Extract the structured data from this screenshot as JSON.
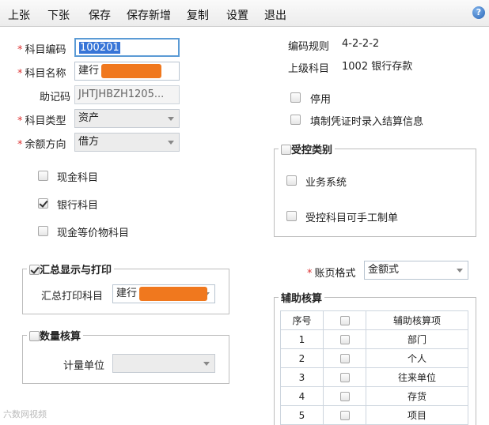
{
  "toolbar": {
    "items": [
      "上张",
      "下张",
      "保存",
      "保存新增",
      "复制",
      "设置",
      "退出"
    ],
    "help_icon": "help-icon",
    "help_glyph": "?"
  },
  "form": {
    "code_label": "科目编码",
    "code_value": "100201",
    "name_label": "科目名称",
    "name_value": "建行",
    "mnemonic_label": "助记码",
    "mnemonic_value": "JHTJHBZH1205...",
    "type_label": "科目类型",
    "type_value": "资产",
    "balance_label": "余额方向",
    "balance_value": "借方",
    "cash_label": "现金科目",
    "bank_label": "银行科目",
    "equiv_label": "现金等价物科目",
    "cash_checked": false,
    "bank_checked": true,
    "equiv_checked": false
  },
  "summary": {
    "legend": "汇总显示与打印",
    "checked": true,
    "print_label": "汇总打印科目",
    "print_value": "建行"
  },
  "qty": {
    "legend": "数量核算",
    "checked": false,
    "unit_label": "计量单位",
    "unit_value": ""
  },
  "right": {
    "rule_label": "编码规则",
    "rule_value": "4-2-2-2",
    "parent_label": "上级科目",
    "parent_value": "1002 银行存款",
    "disable_label": "停用",
    "settle_label": "填制凭证时录入结算信息"
  },
  "controlled": {
    "legend": "受控类别",
    "business_label": "业务系统",
    "manual_label": "受控科目可手工制单"
  },
  "ledger": {
    "label": "账页格式",
    "value": "金额式"
  },
  "aux": {
    "legend": "辅助核算",
    "col_index": "序号",
    "col_item": "辅助核算项",
    "rows": [
      {
        "idx": "1",
        "name": "部门"
      },
      {
        "idx": "2",
        "name": "个人"
      },
      {
        "idx": "3",
        "name": "往来单位"
      },
      {
        "idx": "4",
        "name": "存货"
      },
      {
        "idx": "5",
        "name": "项目"
      }
    ]
  },
  "watermark": "六数网视频",
  "colors": {
    "accent": "#3875d7",
    "required": "#d33333",
    "redaction": "#f0781e"
  }
}
